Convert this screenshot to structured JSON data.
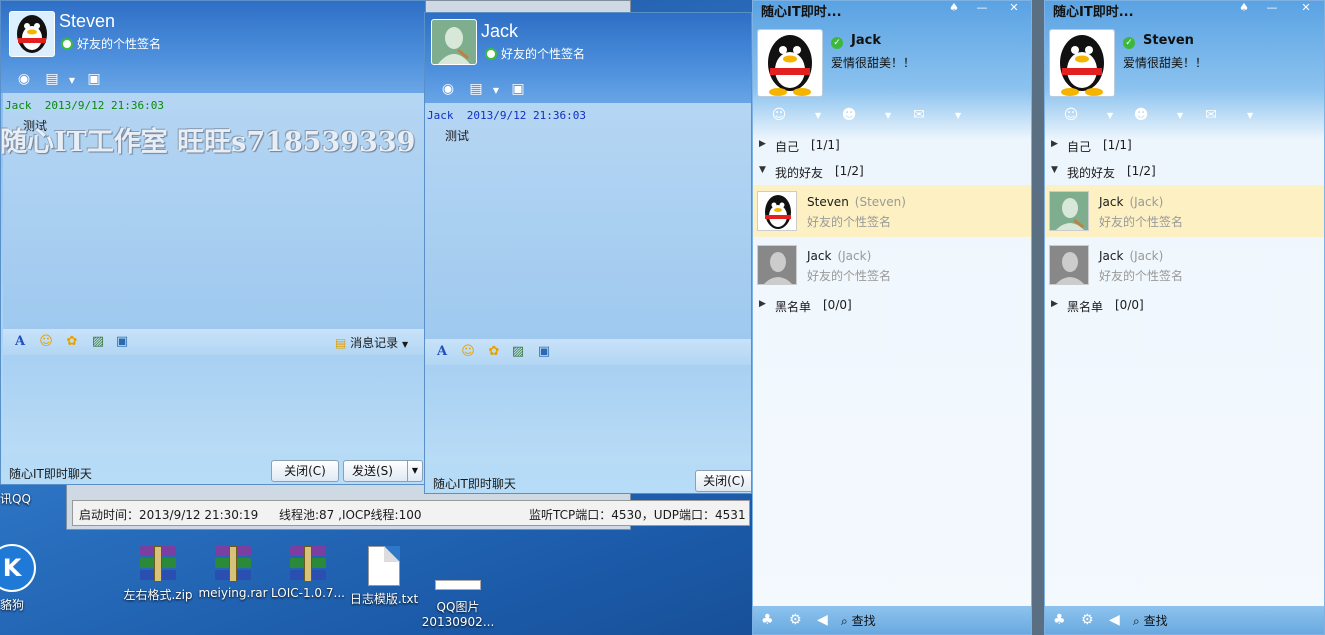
{
  "desktop": {
    "left_label_qq": "讯QQ",
    "left_label_2": "貉狗",
    "icons": [
      {
        "label": "左右格式.zip"
      },
      {
        "label": "meiying.rar"
      },
      {
        "label": "LOIC-1.0.7..."
      },
      {
        "label": "日志模版.txt"
      },
      {
        "label": "QQ图片",
        "label2": "20130902..."
      }
    ]
  },
  "watermark": "随心IT工作室 旺旺s718539339",
  "chat_steven": {
    "name": "Steven",
    "signature": "好友的个性签名",
    "message": {
      "sender": "Jack",
      "time": "2013/9/12 21:36:03",
      "text": "测试"
    },
    "history_label": "消息记录",
    "footer_label": "随心IT即时聊天",
    "close_label": "关闭(C)",
    "send_label": "发送(S)"
  },
  "chat_jack": {
    "name": "Jack",
    "signature": "好友的个性签名",
    "message": {
      "sender": "Jack",
      "time": "2013/9/12 21:36:03",
      "text": "测试"
    },
    "footer_label": "随心IT即时聊天",
    "close_label": "关闭(C)"
  },
  "status_bar": {
    "start_time": "启动时间：2013/9/12 21:30:19",
    "threads": "线程池:87 ,IOCP线程:100",
    "ports": "监听TCP端口：4530，UDP端口：4531"
  },
  "buddy_jack": {
    "title": "随心IT即时...",
    "name": "Jack",
    "mood": "爱情很甜美！！",
    "groups": [
      {
        "label": "自己",
        "count": "[1/1]",
        "expanded": false
      },
      {
        "label": "我的好友",
        "count": "[1/2]",
        "expanded": true
      },
      {
        "label": "黑名单",
        "count": "[0/0]",
        "expanded": false
      }
    ],
    "friends": [
      {
        "name": "Steven",
        "nick": "(Steven)",
        "sig": "好友的个性签名",
        "selected": true
      },
      {
        "name": "Jack",
        "nick": "(Jack)",
        "sig": "好友的个性签名",
        "selected": false
      }
    ],
    "find_label": "查找"
  },
  "buddy_steven": {
    "title": "随心IT即时...",
    "name": "Steven",
    "mood": "爱情很甜美！！",
    "groups": [
      {
        "label": "自己",
        "count": "[1/1]"
      },
      {
        "label": "我的好友",
        "count": "[1/2]"
      },
      {
        "label": "黑名单",
        "count": "[0/0]"
      }
    ],
    "friends": [
      {
        "name": "Jack",
        "nick": "(Jack)",
        "sig": "好友的个性签名",
        "selected": true
      },
      {
        "name": "Jack",
        "nick": "(Jack)",
        "sig": "好友的个性签名",
        "selected": false
      }
    ],
    "find_label": "查找"
  },
  "colors": {
    "desktop_blue": "#2f78c8",
    "selected_row": "#fdf1c4",
    "online_green": "#3cb93c"
  }
}
